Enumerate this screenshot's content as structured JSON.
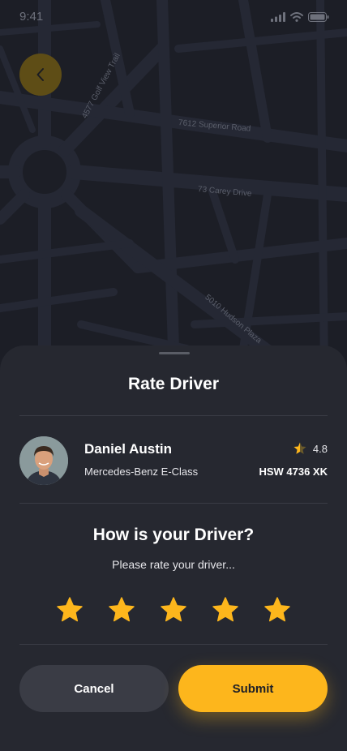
{
  "status_bar": {
    "time": "9:41"
  },
  "map": {
    "streets": [
      "4577 Golf View Trail",
      "7612 Superior Road",
      "73 Carey Drive",
      "5010 Hudson Plaza"
    ]
  },
  "sheet": {
    "title": "Rate Driver",
    "driver": {
      "name": "Daniel Austin",
      "car": "Mercedes-Benz E-Class",
      "rating": "4.8",
      "plate": "HSW 4736 XK"
    },
    "question": "How is your Driver?",
    "subtext": "Please rate your driver...",
    "stars_selected": 5,
    "cancel_label": "Cancel",
    "submit_label": "Submit"
  },
  "colors": {
    "accent": "#fdb61c",
    "sheet_bg": "#262830",
    "map_bg": "#1c1e26"
  }
}
